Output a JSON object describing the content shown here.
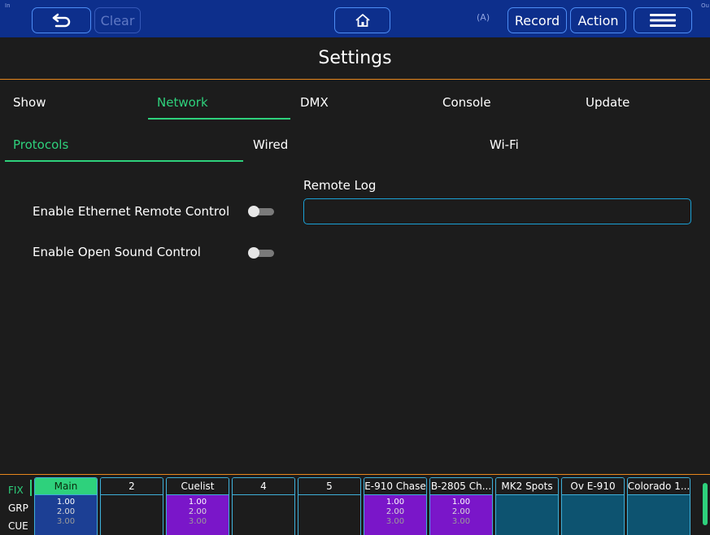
{
  "topbar": {
    "in_label": "In",
    "out_label": "Ou",
    "clear_label": "Clear",
    "antenna_label": "(A)",
    "record_label": "Record",
    "action_label": "Action"
  },
  "page_title": "Settings",
  "tabs": [
    {
      "label": "Show"
    },
    {
      "label": "Network"
    },
    {
      "label": "DMX"
    },
    {
      "label": "Console"
    },
    {
      "label": "Update"
    }
  ],
  "active_tab": "Network",
  "subtabs": [
    {
      "label": "Protocols"
    },
    {
      "label": "Wired"
    },
    {
      "label": "Wi-Fi"
    }
  ],
  "active_subtab": "Protocols",
  "settings": {
    "ethernet_remote_label": "Enable Ethernet Remote Control",
    "ethernet_remote_on": false,
    "osc_label": "Enable Open Sound Control",
    "osc_on": false,
    "remote_log_label": "Remote Log",
    "remote_log_value": ""
  },
  "bottom": {
    "side_labels": [
      "FIX",
      "GRP",
      "CUE"
    ],
    "active_side": "FIX",
    "playbacks": [
      {
        "name": "Main",
        "values": [
          "1.00",
          "2.00",
          "3.00"
        ],
        "color": "#1c3f94",
        "active": true
      },
      {
        "name": "2",
        "values": [],
        "color": "#1c1c1c",
        "active": false
      },
      {
        "name": "Cuelist",
        "values": [
          "1.00",
          "2.00",
          "3.00"
        ],
        "color": "#7a16c9",
        "active": false
      },
      {
        "name": "4",
        "values": [],
        "color": "#1c1c1c",
        "active": false
      },
      {
        "name": "5",
        "values": [],
        "color": "#1c1c1c",
        "active": false
      },
      {
        "name": "E-910 Chase",
        "values": [
          "1.00",
          "2.00",
          "3.00"
        ],
        "color": "#7a16c9",
        "active": false
      },
      {
        "name": "B-2805 Ch...",
        "values": [
          "1.00",
          "2.00",
          "3.00"
        ],
        "color": "#7a16c9",
        "active": false
      },
      {
        "name": "MK2 Spots",
        "values": [],
        "color": "#0d5370",
        "active": false
      },
      {
        "name": "Ov E-910",
        "values": [],
        "color": "#0d5370",
        "active": false
      },
      {
        "name": "Colorado 1...",
        "values": [],
        "color": "#0d5370",
        "active": false
      }
    ]
  },
  "colors": {
    "topbar": "#0d2f8c",
    "accent_green": "#2ed17c",
    "accent_orange": "#e8871c",
    "input_border": "#1aa1d6"
  }
}
